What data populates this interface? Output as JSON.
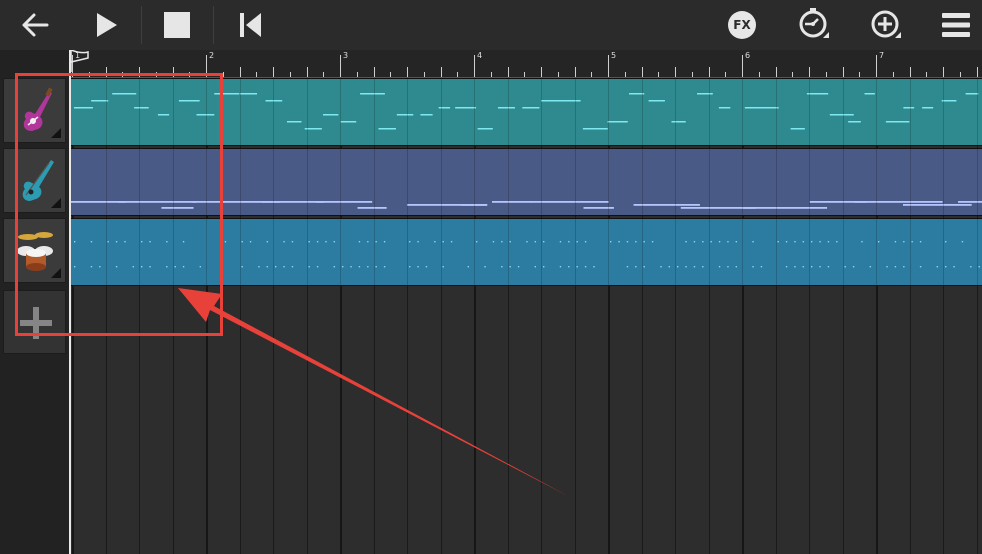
{
  "toolbar": {
    "back": "back-arrow-icon",
    "play": "play-icon",
    "stop": "stop-icon",
    "rewind": "skip-to-start-icon",
    "fx_label": "FX",
    "metronome": "metronome-icon",
    "add": "add-circle-icon",
    "menu": "hamburger-menu-icon"
  },
  "ruler": {
    "bars": [
      "1",
      "2",
      "3",
      "4",
      "5",
      "6",
      "7"
    ]
  },
  "tracks": [
    {
      "name": "electric-guitar",
      "icon": "electric-guitar-icon",
      "color": "#2e8a8e",
      "note_color": "#7fe9f2"
    },
    {
      "name": "bass-guitar",
      "icon": "bass-guitar-icon",
      "color": "#4a5a86",
      "note_color": "#b5c6ff"
    },
    {
      "name": "drums",
      "icon": "drum-kit-icon",
      "color": "#2b7ca0",
      "note_color": "#8fd3ea"
    }
  ],
  "add_track": {
    "icon": "plus-icon"
  },
  "colors": {
    "toolbar": "#2b2b2b",
    "annotation": "#e8413a"
  }
}
